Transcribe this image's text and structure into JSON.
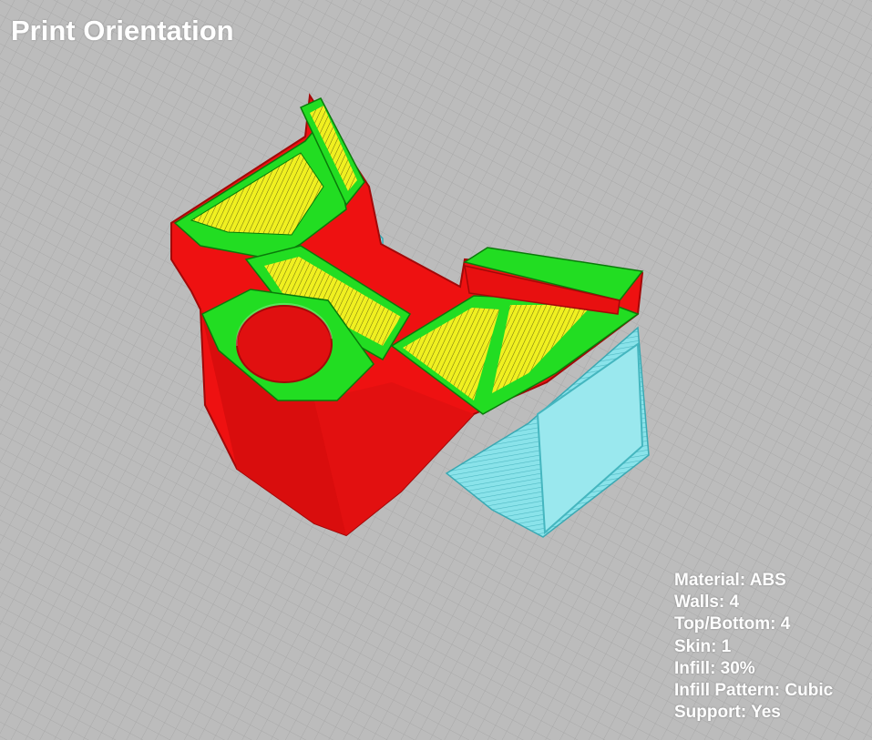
{
  "title": "Print Orientation",
  "settings": [
    {
      "label": "Material",
      "value": "ABS"
    },
    {
      "label": "Walls",
      "value": "4"
    },
    {
      "label": "Top/Bottom",
      "value": "4"
    },
    {
      "label": "Skin",
      "value": "1"
    },
    {
      "label": "Infill",
      "value": "30%"
    },
    {
      "label": "Infill Pattern",
      "value": "Cubic"
    },
    {
      "label": "Support",
      "value": "Yes"
    }
  ],
  "colors": {
    "background": "#bcbcbc",
    "grid_line": "#a9a9a9",
    "wall_outer": "#ee1111",
    "wall_inner": "#22dd22",
    "infill": "#f0f020",
    "support": "#66d8e0"
  }
}
